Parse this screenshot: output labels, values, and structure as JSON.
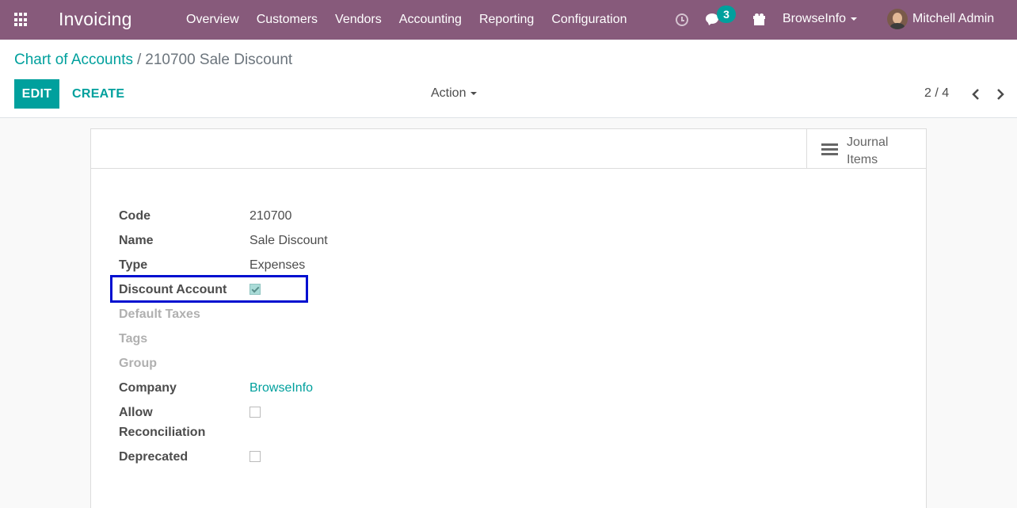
{
  "navbar": {
    "app_title": "Invoicing",
    "menu": [
      "Overview",
      "Customers",
      "Vendors",
      "Accounting",
      "Reporting",
      "Configuration"
    ],
    "messages_count": "3",
    "company": "BrowseInfo",
    "user": "Mitchell Admin",
    "color": "#875a7b"
  },
  "breadcrumb": {
    "parent": "Chart of Accounts",
    "separator": "/",
    "current": "210700 Sale Discount"
  },
  "toolbar": {
    "edit_label": "EDIT",
    "create_label": "CREATE",
    "action_label": "Action",
    "pager": "2 / 4",
    "accent": "#00a09d"
  },
  "smart_buttons": {
    "journal_items_label_1": "Journal",
    "journal_items_label_2": "Items"
  },
  "form": {
    "code_label": "Code",
    "code_value": "210700",
    "name_label": "Name",
    "name_value": "Sale Discount",
    "type_label": "Type",
    "type_value": "Expenses",
    "discount_label": "Discount Account",
    "discount_checked": true,
    "taxes_label": "Default Taxes",
    "tags_label": "Tags",
    "group_label": "Group",
    "company_label": "Company",
    "company_value": "BrowseInfo",
    "reconcile_label_1": "Allow",
    "reconcile_label_2": "Reconciliation",
    "reconcile_checked": false,
    "deprecated_label": "Deprecated",
    "deprecated_checked": false
  }
}
